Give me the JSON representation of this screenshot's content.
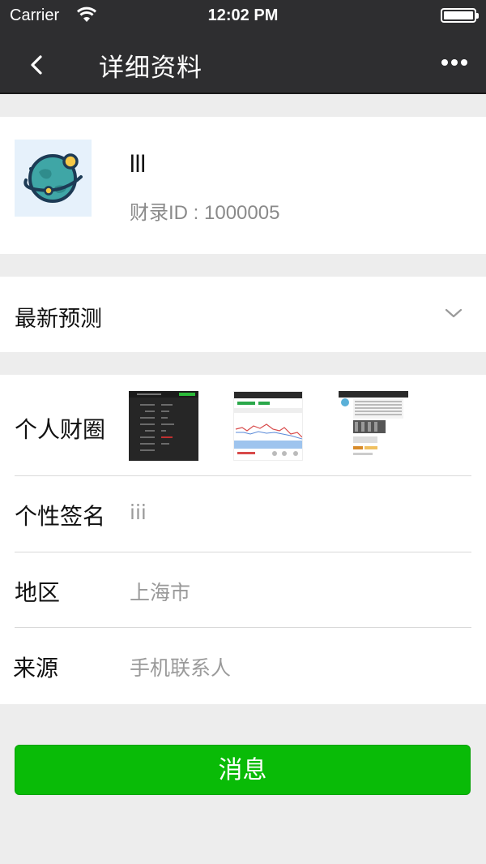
{
  "status_bar": {
    "carrier": "Carrier",
    "time": "12:02 PM"
  },
  "nav": {
    "title": "详细资料"
  },
  "profile": {
    "name": "lll",
    "uid": "财录ID : 1000005"
  },
  "forecast": {
    "label": "最新预测"
  },
  "info": {
    "circle_label": "个人财圈",
    "signature_label": "个性签名",
    "signature_value": "iii",
    "region_label": "地区",
    "region_value": "上海市",
    "source_label": "来源",
    "source_value": "手机联系人"
  },
  "message_button": {
    "label": "消息"
  },
  "colors": {
    "nav_bg": "#2e2e30",
    "button_green": "#09bb07",
    "page_bg": "#ededed",
    "secondary_text": "#9a9a9a"
  },
  "icons": [
    "back-icon",
    "more-icon",
    "wifi-icon",
    "battery-icon",
    "chevron-down-icon",
    "planet-avatar-icon"
  ]
}
